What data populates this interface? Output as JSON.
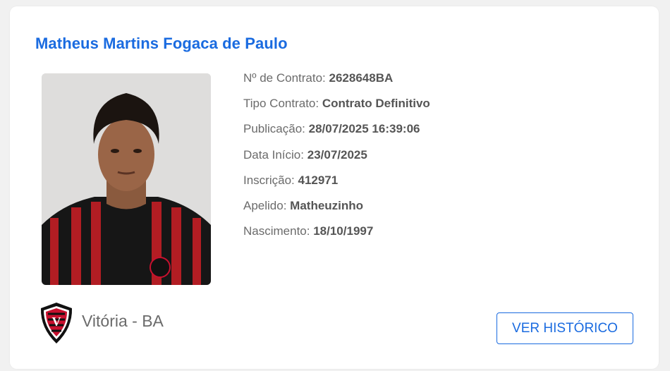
{
  "player": {
    "name": "Matheus Martins Fogaca de Paulo",
    "photo_icon": "player-photo"
  },
  "details": [
    {
      "label": "Nº de Contrato:",
      "value": "2628648BA"
    },
    {
      "label": "Tipo Contrato:",
      "value": "Contrato Definitivo"
    },
    {
      "label": "Publicação:",
      "value": "28/07/2025 16:39:06"
    },
    {
      "label": "Data Início:",
      "value": "23/07/2025"
    },
    {
      "label": "Inscrição:",
      "value": "412971"
    },
    {
      "label": "Apelido:",
      "value": "Matheuzinho"
    },
    {
      "label": "Nascimento:",
      "value": "18/10/1997"
    }
  ],
  "club": {
    "name": "Vitória - BA",
    "crest_icon": "club-crest-icon",
    "colors": {
      "red": "#c8102e",
      "black": "#111111"
    }
  },
  "actions": {
    "history_label": "VER HISTÓRICO"
  },
  "colors": {
    "accent": "#1a6be0",
    "text": "#6b6b6b"
  }
}
